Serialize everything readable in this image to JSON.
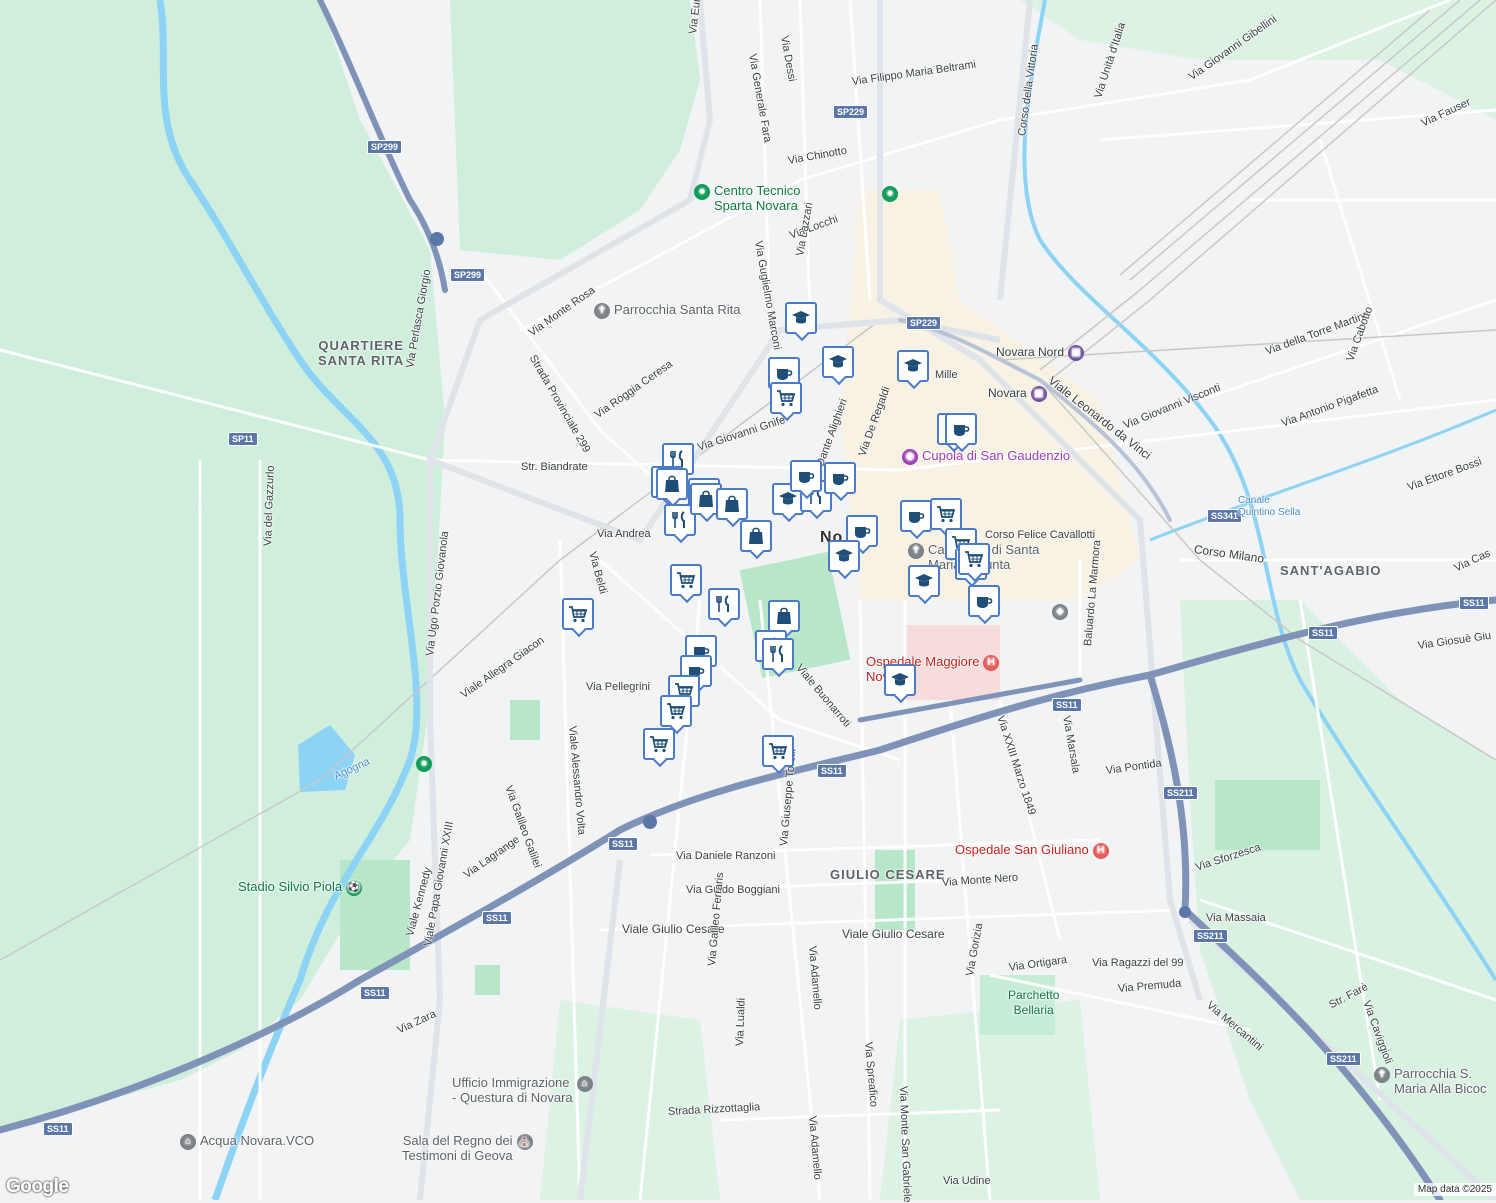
{
  "map": {
    "provider": "Google",
    "attribution": "Map data ©2025",
    "colors": {
      "land": "#f1f3f4",
      "park": "#cfefdc",
      "water": "#8cd3f5",
      "highway": "#7f93b8",
      "marker_border": "#4a7bc8",
      "marker_icon": "#1f4e79"
    }
  },
  "areas": [
    {
      "id": "santa-rita",
      "text": "QUARTIERE\nSANTA RITA"
    },
    {
      "id": "sant-agabio",
      "text": "SANT'AGABIO"
    },
    {
      "id": "giulio-cesare",
      "text": "GIULIO CESARE"
    },
    {
      "id": "novara",
      "text": "No"
    }
  ],
  "streets": [
    "Via Europa",
    "Via Generale Fara",
    "Via Dessi",
    "Via Filippo Maria Beltrami",
    "Corso della Vittoria",
    "Via Unità d'Italia",
    "Via Giovanni Gibellini",
    "Via Fauser",
    "Via Chinotto",
    "Via Locchi",
    "Via Lazzari",
    "Via Guglielmo Marconi",
    "Via Monte Rosa",
    "Via Perlasca Giorgio",
    "Strada Provinciale 299",
    "Via Roggia Ceresa",
    "Via Giovanni Gnife",
    "Str. Biandrate",
    "Via Andrea",
    "Via Beldi",
    "Viale Allegra Giacon",
    "Via Ugo Porzio Giovanola",
    "Via del Gazzurlo",
    "Via Pellegrini",
    "Viale Alessandro Volta",
    "Via Galileo Galilei",
    "Viale Papa Giovanni XXIII",
    "Viale Kennedy",
    "Via Lagrange",
    "Via Zara",
    "Via Daniele Ranzoni",
    "Via Guido Boggiani",
    "Viale Giulio Cesare",
    "Viale Giulio Cesare",
    "Via Galileo Ferraris",
    "Via Lualdi",
    "Via Giuseppe Torelli",
    "Via Adamello",
    "Via Adamello",
    "Via Spreafico",
    "Via Monte San Gabriele",
    "Via Udine",
    "Strada Rizzottaglia",
    "Via Gorizia",
    "Via Ortigara",
    "Via Ragazzi del 99",
    "Via Premuda",
    "Via Monte Nero",
    "Via Pontida",
    "Via Marsala",
    "Baluardo La Marmora",
    "Via XXIII Marzo 1849",
    "Viale Buonarroti",
    "Corso Felice Cavallotti",
    "Corso Milano",
    "Viale Leonardo da Vinci",
    "Via Giovanni Visconti",
    "Via della Torre Martino",
    "Via Cabotto",
    "Via Antonio Pigafetta",
    "Via Ettore Bossi",
    "Via Sforzesca",
    "Via Massaia",
    "Via Mercantini",
    "Str. Farè",
    "Via Caviggioli",
    "Via Giosuè Giu",
    "Via Cas",
    "Mille",
    "Dante Alighieri",
    "Via De Regaldi",
    "Via Lazzari"
  ],
  "road_shields": [
    "SP299",
    "SP299",
    "SP11",
    "SP229",
    "SP229",
    "SS341",
    "SS11",
    "SS11",
    "SS11",
    "SS11",
    "SS11",
    "SS11",
    "SS11",
    "SS211",
    "SS211",
    "SS211",
    "SS11"
  ],
  "pois": [
    {
      "name": "Centro Tecnico\nSparta Novara",
      "icon": "park-pin-icon",
      "color": "#0f9d58"
    },
    {
      "name": "Parrocchia Santa Rita",
      "icon": "church-icon",
      "color": "#7b8288"
    },
    {
      "name": "Novara Nord",
      "icon": "train-station-icon",
      "color": "#6b4f9e"
    },
    {
      "name": "Novara",
      "icon": "train-station-icon",
      "color": "#6b4f9e"
    },
    {
      "name": "Cupola di San Gaudenzio",
      "icon": "camera-icon",
      "color": "#9c3fb8"
    },
    {
      "name": "Cattedrale di Santa\nMaria Assunta",
      "icon": "church-icon",
      "color": "#7b8288"
    },
    {
      "name": "Ospedale Maggiore\nNovara",
      "icon": "hospital-icon",
      "color": "#e35d5b"
    },
    {
      "name": "Ospedale San Giuliano",
      "icon": "hospital-icon",
      "color": "#e35d5b"
    },
    {
      "name": "Stadio Silvio Piola",
      "icon": "stadium-icon",
      "color": "#0f9d58"
    },
    {
      "name": "Parchetto\nBellaria",
      "icon": "",
      "color": "#0f9d58"
    },
    {
      "name": "Ufficio Immigrazione\n- Questura di Novara",
      "icon": "government-icon",
      "color": "#7b8288"
    },
    {
      "name": "Acqua Novara.VCO",
      "icon": "government-icon",
      "color": "#7b8288"
    },
    {
      "name": "Sala del Regno dei\nTestimoni di Geova",
      "icon": "church-icon",
      "color": "#7b8288"
    },
    {
      "name": "Parrocchia S.\nMaria Alla Bicoc",
      "icon": "church-icon",
      "color": "#7b8288"
    },
    {
      "name": "Agogna",
      "icon": "",
      "color": "#4a90c8"
    },
    {
      "name": "Canale\nQuintino Sella",
      "icon": "",
      "color": "#4a90c8"
    }
  ],
  "markers": [
    {
      "type": "school"
    },
    {
      "type": "cafe"
    },
    {
      "type": "grocery"
    },
    {
      "type": "school"
    },
    {
      "type": "school"
    },
    {
      "type": "cafe"
    },
    {
      "type": "cafe"
    },
    {
      "type": "restaurant"
    },
    {
      "type": "shopping"
    },
    {
      "type": "shopping"
    },
    {
      "type": "shopping"
    },
    {
      "type": "restaurant"
    },
    {
      "type": "shopping"
    },
    {
      "type": "shopping"
    },
    {
      "type": "school"
    },
    {
      "type": "shopping"
    },
    {
      "type": "restaurant"
    },
    {
      "type": "cafe"
    },
    {
      "type": "cafe"
    },
    {
      "type": "cafe"
    },
    {
      "type": "cafe"
    },
    {
      "type": "grocery"
    },
    {
      "type": "school"
    },
    {
      "type": "grocery"
    },
    {
      "type": "cafe"
    },
    {
      "type": "school"
    },
    {
      "type": "cafe"
    },
    {
      "type": "grocery"
    },
    {
      "type": "grocery"
    },
    {
      "type": "restaurant"
    },
    {
      "type": "shopping"
    },
    {
      "type": "restaurant"
    },
    {
      "type": "restaurant"
    },
    {
      "type": "cafe"
    },
    {
      "type": "cafe"
    },
    {
      "type": "grocery"
    },
    {
      "type": "grocery"
    },
    {
      "type": "grocery"
    },
    {
      "type": "grocery"
    },
    {
      "type": "school"
    },
    {
      "type": "grocery"
    }
  ]
}
